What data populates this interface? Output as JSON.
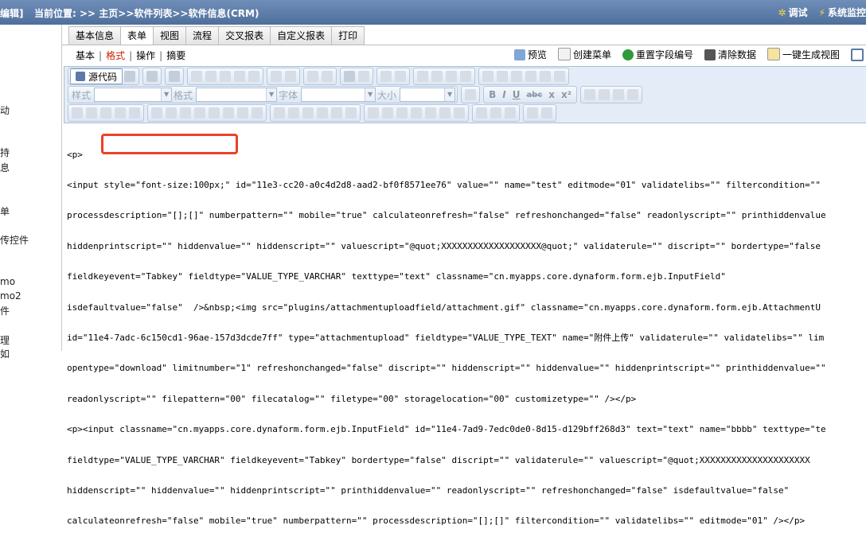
{
  "topbar": {
    "left_fragment": "编辑]",
    "breadcrumb": "当前位置: >> 主页>>软件列表>>软件信息(CRM)",
    "debug": "调试",
    "sysmon": "系统监控"
  },
  "leftnav": [
    "动",
    "持",
    "息",
    "单",
    "传控件",
    "mo",
    "mo2",
    "件",
    "理",
    "如"
  ],
  "tabs": [
    "基本信息",
    "表单",
    "视图",
    "流程",
    "交叉报表",
    "自定义报表",
    "打印"
  ],
  "active_tab": "表单",
  "subtabs": [
    "基本",
    "格式",
    "操作",
    "摘要"
  ],
  "active_subtab": "格式",
  "actions": [
    "预览",
    "创建菜单",
    "重置字段编号",
    "清除数据",
    "一键生成视图"
  ],
  "colors": {
    "highlight": "#e8422d",
    "active_subtab": "#cc2200"
  },
  "toolbar": {
    "source_label": "源代码",
    "style_label": "样式",
    "format_label": "格式",
    "font_label": "字体",
    "size_label": "大小",
    "bold": "B",
    "italic": "I",
    "underline": "U",
    "strike": "abc",
    "subscript": "x",
    "superscript": "x²"
  },
  "code_lines": [
    "<p>",
    "<input style=\"font-size:100px;\" id=\"11e3-cc20-a0c4d2d8-aad2-bf0f8571ee76\" value=\"\" name=\"test\" editmode=\"01\" validatelibs=\"\" filtercondition=\"\"",
    "processdescription=\"[];[]\" numberpattern=\"\" mobile=\"true\" calculateonrefresh=\"false\" refreshonchanged=\"false\" readonlyscript=\"\" printhiddenvalue",
    "hiddenprintscript=\"\" hiddenvalue=\"\" hiddenscript=\"\" valuescript=\"@quot;XXXXXXXXXXXXXXXXXXX@quot;\" validaterule=\"\" discript=\"\" bordertype=\"false",
    "fieldkeyevent=\"Tabkey\" fieldtype=\"VALUE_TYPE_VARCHAR\" texttype=\"text\" classname=\"cn.myapps.core.dynaform.form.ejb.InputField\"",
    "isdefaultvalue=\"false\"  />&nbsp;<img src=\"plugins/attachmentuploadfield/attachment.gif\" classname=\"cn.myapps.core.dynaform.form.ejb.AttachmentU",
    "id=\"11e4-7adc-6c150cd1-96ae-157d3dcde7ff\" type=\"attachmentupload\" fieldtype=\"VALUE_TYPE_TEXT\" name=\"附件上传\" validaterule=\"\" validatelibs=\"\" lim",
    "opentype=\"download\" limitnumber=\"1\" refreshonchanged=\"false\" discript=\"\" hiddenscript=\"\" hiddenvalue=\"\" hiddenprintscript=\"\" printhiddenvalue=\"\"",
    "readonlyscript=\"\" filepattern=\"00\" filecatalog=\"\" filetype=\"00\" storagelocation=\"00\" customizetype=\"\" /></p>",
    "<p><input classname=\"cn.myapps.core.dynaform.form.ejb.InputField\" id=\"11e4-7ad9-7edc0de0-8d15-d129bff268d3\" text=\"text\" name=\"bbbb\" texttype=\"te",
    "fieldtype=\"VALUE_TYPE_VARCHAR\" fieldkeyevent=\"Tabkey\" bordertype=\"false\" discript=\"\" validaterule=\"\" valuescript=\"@quot;XXXXXXXXXXXXXXXXXXXXX",
    "hiddenscript=\"\" hiddenvalue=\"\" hiddenprintscript=\"\" printhiddenvalue=\"\" readonlyscript=\"\" refreshonchanged=\"false\" isdefaultvalue=\"false\"",
    "calculateonrefresh=\"false\" mobile=\"true\" numberpattern=\"\" processdescription=\"[];[]\" filtercondition=\"\" validatelibs=\"\" editmode=\"01\" /></p>"
  ]
}
